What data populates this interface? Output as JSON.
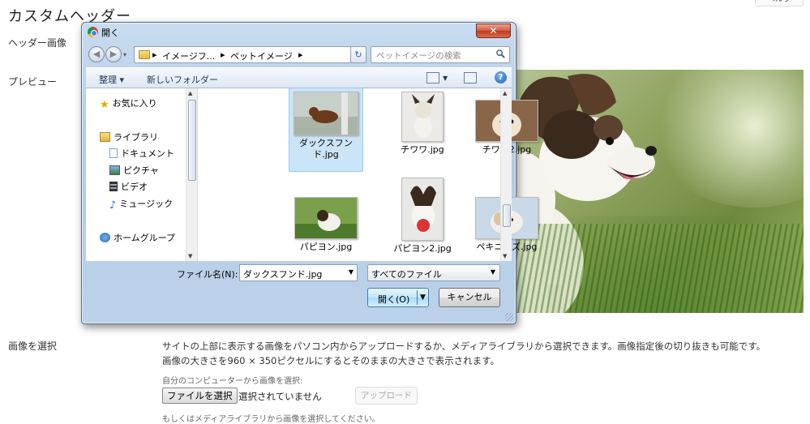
{
  "page": {
    "title": "カスタムヘッダー",
    "help_tab": "ヘルプ",
    "rows": {
      "header_image": "ヘッダー画像",
      "preview": "プレビュー",
      "select_image": "画像を選択"
    },
    "description_line1": "サイトの上部に表示する画像をパソコン内からアップロードするか、メディアライブラリから選択できます。画像指定後の切り抜きも可能です。",
    "description_line2": "画像の大きさを960 × 350ピクセルにするとそのままの大きさで表示されます。",
    "from_computer_label": "自分のコンピューターから画像を選択:",
    "choose_file_button": "ファイルを選択",
    "no_file_selected": "選択されていません",
    "upload_button": "アップロード",
    "media_library_label": "もしくはメディアライブラリから画像を選択してください。"
  },
  "dialog": {
    "title": "開く",
    "close_glyph": "✕",
    "address": {
      "crumbs": [
        "イメージフ...",
        "ペットイメージ"
      ],
      "separator": "▸"
    },
    "search_placeholder": "ペットイメージの検索",
    "toolbar": {
      "organize": "整理 ▾",
      "new_folder": "新しいフォルダー"
    },
    "nav_pane": {
      "favorites": "お気に入り",
      "libraries": "ライブラリ",
      "documents": "ドキュメント",
      "pictures": "ピクチャ",
      "videos": "ビデオ",
      "music": "ミュージック",
      "homegroup": "ホームグループ"
    },
    "files": [
      {
        "name": "ダックスフンド.jpg",
        "selected": true
      },
      {
        "name": "チワワ.jpg",
        "selected": false
      },
      {
        "name": "チワワ2.jpg",
        "selected": false
      },
      {
        "name": "パピヨン.jpg",
        "selected": false
      },
      {
        "name": "パピヨン2.jpg",
        "selected": false
      },
      {
        "name": "ペキニーズ.jpg",
        "selected": false
      }
    ],
    "file_name_label": "ファイル名(N):",
    "file_name_value": "ダックスフンド.jpg",
    "file_type_filter": "すべてのファイル",
    "open_button": "開く(O)",
    "cancel_button": "キャンセル"
  },
  "colors": {
    "dialog_frame": "#b2cbe6",
    "selection": "#cce4f7",
    "close_button": "#c0391d"
  }
}
